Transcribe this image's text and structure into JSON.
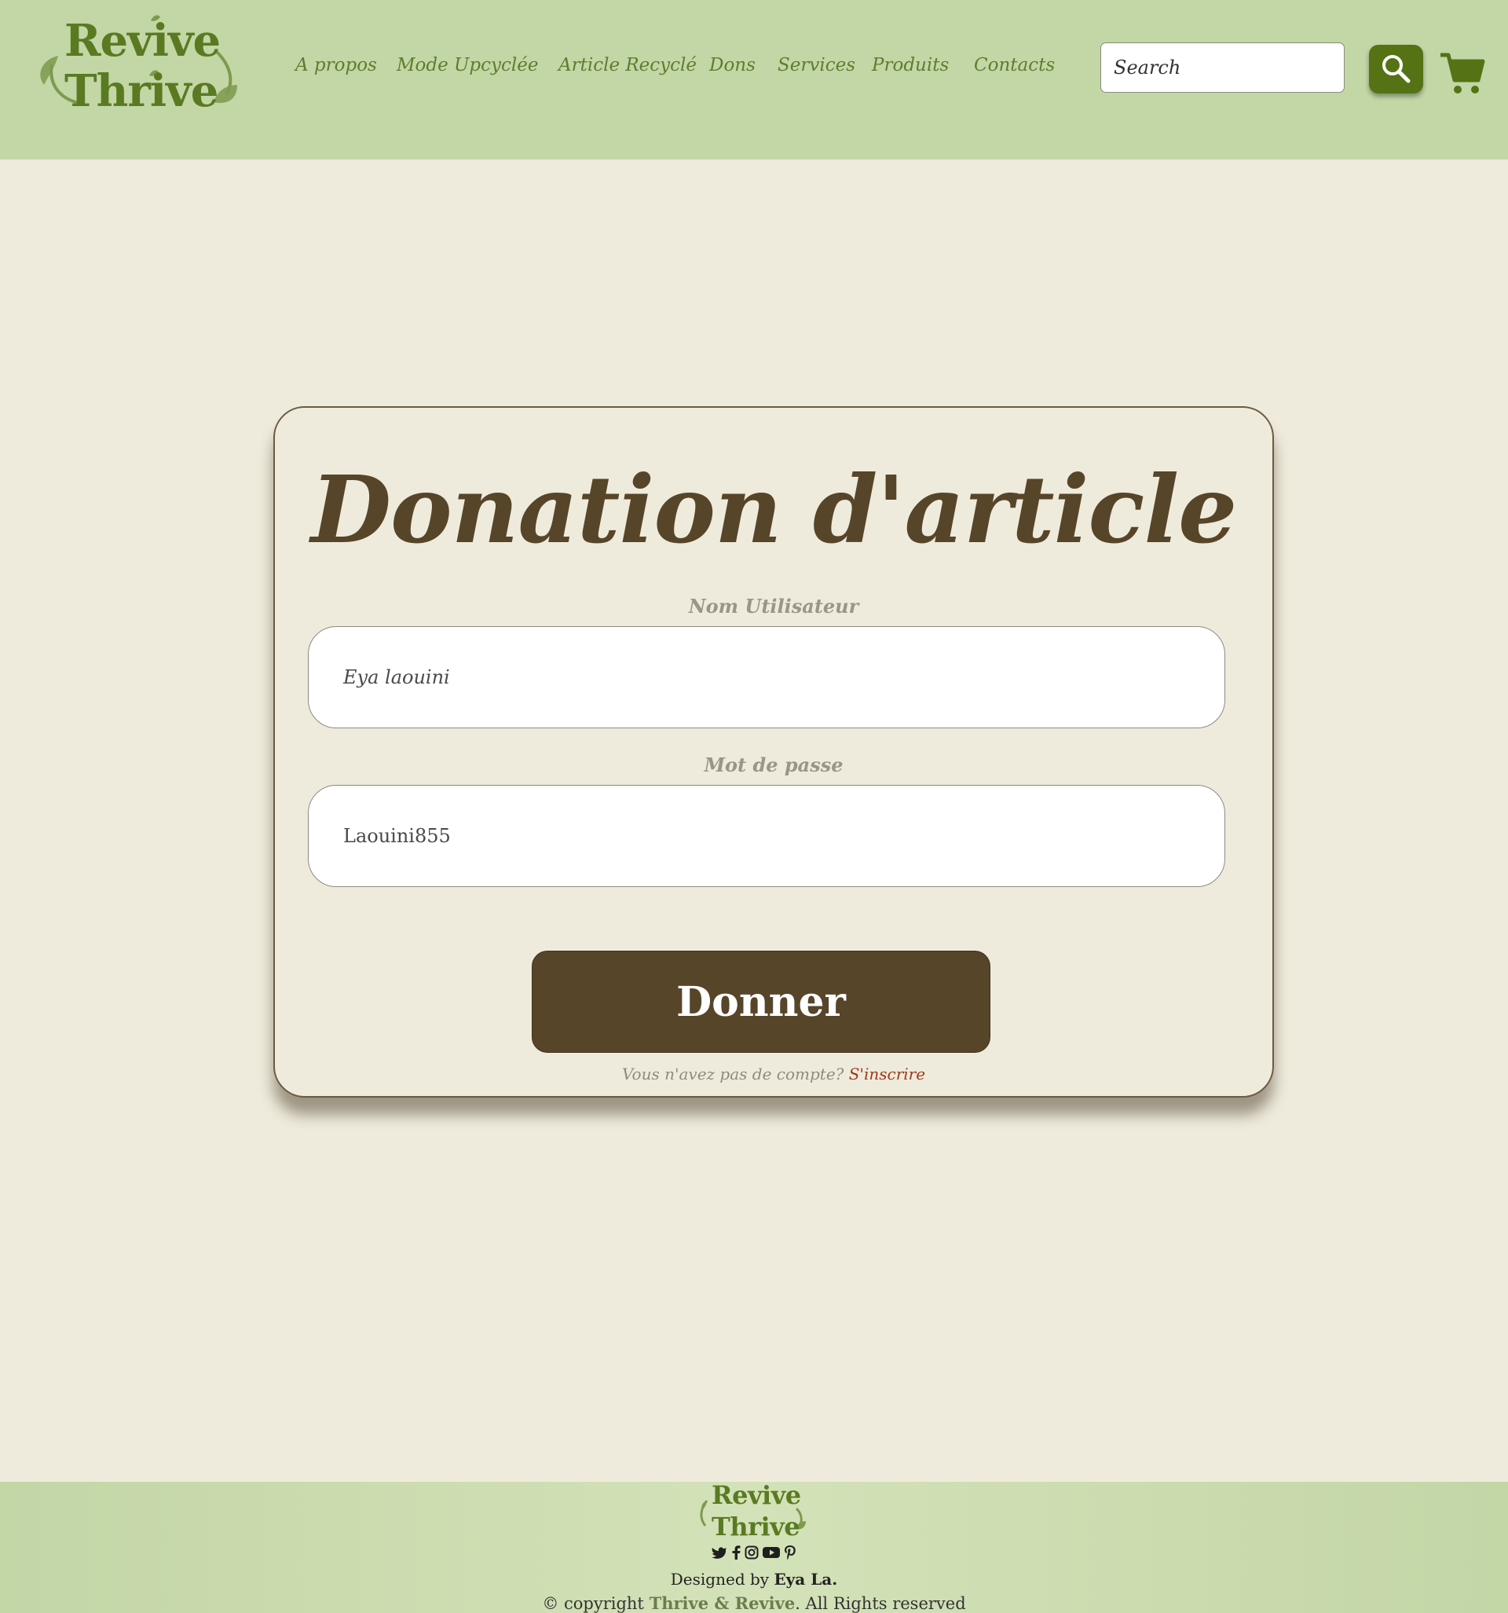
{
  "header": {
    "logo": {
      "line1": "Revive",
      "line2": "Thrive"
    },
    "nav": [
      {
        "label": "A propos"
      },
      {
        "label": "Mode Upcyclée"
      },
      {
        "label": "Article Recyclé"
      },
      {
        "label": "Dons"
      },
      {
        "label": "Services"
      },
      {
        "label": "Produits"
      },
      {
        "label": "Contacts"
      }
    ],
    "search": {
      "value": "Search"
    },
    "search_icon": "magnifier-icon",
    "cart_icon": "shopping-cart-icon"
  },
  "form": {
    "title": "Donation d'article",
    "username_label": "Nom Utilisateur",
    "username_value": "Eya laouini",
    "password_label": "Mot de passe",
    "password_value": "Laouini855",
    "submit_label": "Donner",
    "signup_prompt": "Vous n'avez pas de compte?",
    "signup_link": "S'inscrire"
  },
  "footer": {
    "logo": {
      "line1": "Revive",
      "line2": "Thrive"
    },
    "social_icons": [
      "twitter-icon",
      "facebook-icon",
      "instagram-icon",
      "youtube-icon",
      "pinterest-icon"
    ],
    "designed_by_label": "Designed by",
    "designer": "Eya La.",
    "copyright_prefix": "© copyright",
    "copyright_brand": "Thrive & Revive",
    "copyright_suffix": ". All Rights reserved"
  },
  "colors": {
    "header_bg": "#c3d6a6",
    "page_bg": "#efebdc",
    "brand_green": "#557314",
    "brown": "#57452a",
    "signup_link": "#9a3a1a"
  }
}
